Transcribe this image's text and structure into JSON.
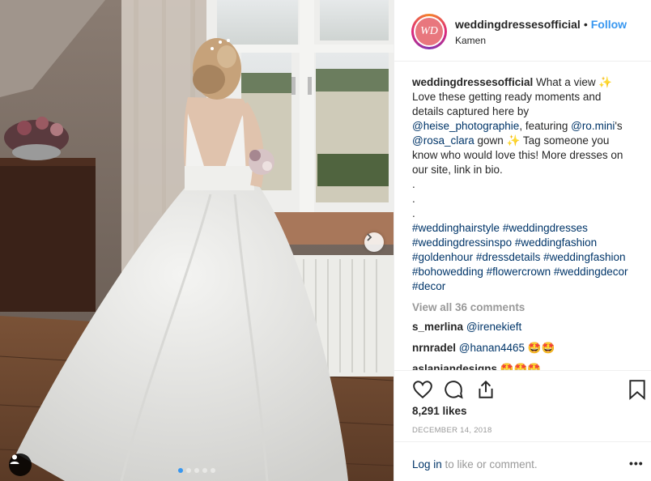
{
  "post": {
    "account": "weddingdressesofficial",
    "separator": "•",
    "follow_label": "Follow",
    "location": "Kamen",
    "avatar_initials": "WD",
    "caption_user": "weddingdressesofficial",
    "caption_parts": {
      "p1": " What a view ✨ Love these getting ready moments and details captured here by ",
      "mention1": "@heise_photographie",
      "p2": ", featuring ",
      "mention2": "@ro.mini",
      "p3": "'s ",
      "mention3": "@rosa_clara",
      "p4": " gown ✨ Tag someone you know who would love this! More dresses on our site, link in bio."
    },
    "dots_lines": [
      ".",
      ".",
      "."
    ],
    "hashtags": [
      "#weddinghairstyle",
      "#weddingdresses",
      "#weddingdressinspo",
      "#weddingfashion",
      "#goldenhour",
      "#dressdetails",
      "#weddingfashion",
      "#bohowedding",
      "#flowercrown",
      "#weddingdecor",
      "#decor"
    ],
    "view_all_comments": "View all 36 comments",
    "comments": [
      {
        "user": "s_merlina",
        "text": "@irenekieft"
      },
      {
        "user": "nrnradel",
        "text": "@hanan4465 🤩🤩"
      },
      {
        "user": "aslaniandesigns",
        "text": "🤩🤩🤩"
      }
    ],
    "likes": "8,291 likes",
    "date": "DECEMBER 14, 2018",
    "login_link": "Log in",
    "login_rest": " to like or comment.",
    "more_label": "•••",
    "carousel": {
      "count": 5,
      "active": 0
    }
  },
  "icons": {
    "like": "heart-icon",
    "comment": "comment-icon",
    "share": "share-icon",
    "save": "bookmark-icon",
    "next": "chevron-right-icon",
    "user_tag": "user-tag-icon"
  },
  "colors": {
    "accent": "#3897f0",
    "link": "#003569",
    "muted": "#999999",
    "text": "#262626"
  }
}
